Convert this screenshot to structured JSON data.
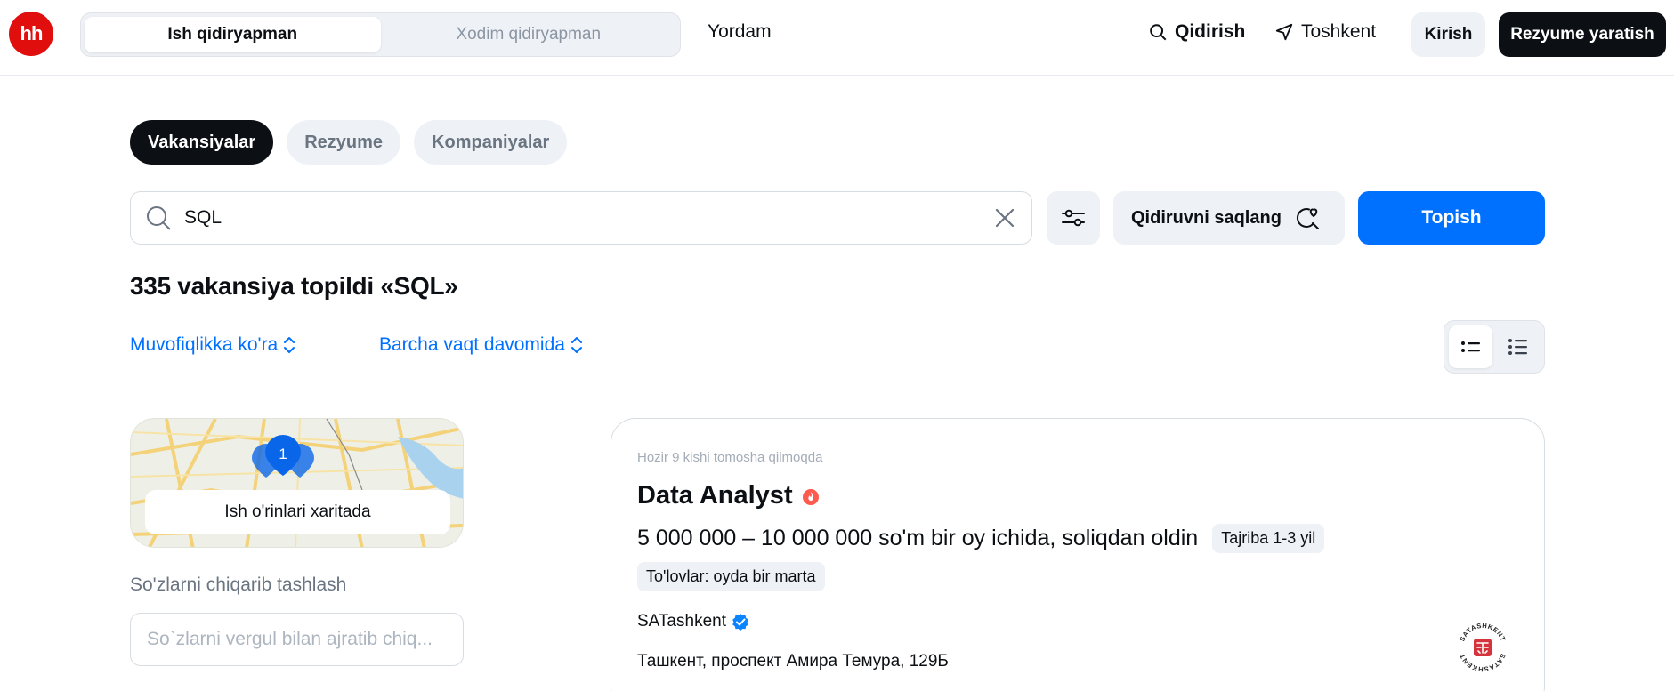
{
  "header": {
    "logo_text": "hh",
    "role_switch": {
      "active": "Ish qidiryapman",
      "inactive": "Xodim qidiryapman"
    },
    "help": "Yordam",
    "search": "Qidirish",
    "city": "Toshkent",
    "login": "Kirish",
    "create_resume": "Rezyume yaratish"
  },
  "tabs": [
    {
      "label": "Vakansiyalar",
      "active": true
    },
    {
      "label": "Rezyume",
      "active": false
    },
    {
      "label": "Kompaniyalar",
      "active": false
    }
  ],
  "search": {
    "value": "SQL",
    "save_label": "Qidiruvni saqlang",
    "find_label": "Topish"
  },
  "results_title": "335 vakansiya topildi «SQL»",
  "sort": {
    "relevance": "Muvofiqlikka ko'ra",
    "period": "Barcha vaqt davomida"
  },
  "map": {
    "count": "1",
    "label": "Ish o'rinlari xaritada"
  },
  "exclude": {
    "label": "So'zlarni chiqarib tashlash",
    "placeholder": "So`zlarni vergul bilan ajratib chiq..."
  },
  "vacancy": {
    "viewers": "Hozir 9 kishi tomosha qilmoqda",
    "title": "Data Analyst",
    "salary": "5 000 000 – 10 000 000 so'm bir oy ichida, soliqdan oldin",
    "experience": "Tajriba 1-3 yil",
    "payments": "To'lovlar: oyda bir marta",
    "company": "SATashkent",
    "address": "Ташкент, проспект Амира Темура, 129Б",
    "logo_text": "SATASHKENT"
  },
  "colors": {
    "accent": "#0070ff",
    "brand_red": "#e10e0e",
    "dark": "#0c1014"
  }
}
